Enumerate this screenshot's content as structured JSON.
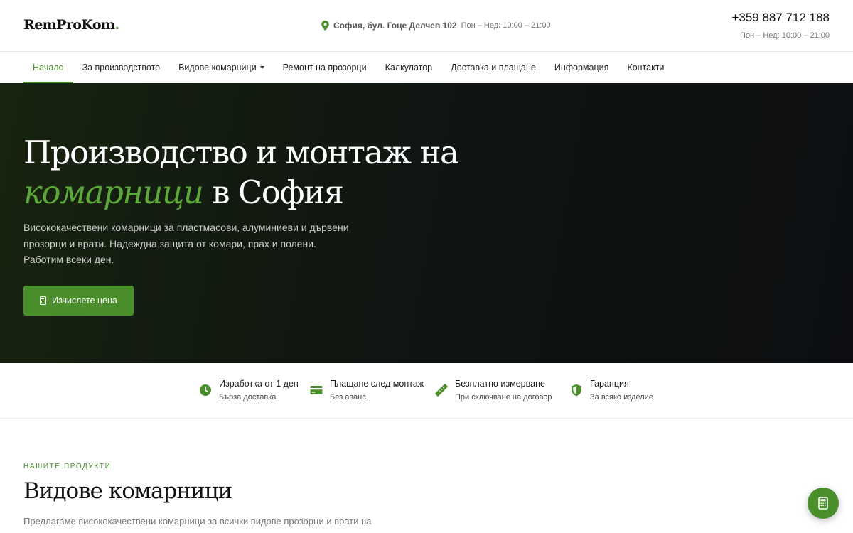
{
  "header": {
    "logo_main": "RemProKom",
    "logo_dot": ".",
    "address": "София, бул. Гоце Делчев 102",
    "address_hours": "Пон – Нед: 10:00 – 21:00",
    "phone": "+359 887 712 188",
    "phone_hours": "Пон – Нед: 10:00 – 21:00"
  },
  "nav": {
    "items": [
      {
        "label": "Начало"
      },
      {
        "label": "За производството"
      },
      {
        "label": "Видове комарници"
      },
      {
        "label": "Ремонт на прозорци"
      },
      {
        "label": "Калкулатор"
      },
      {
        "label": "Доставка и плащане"
      },
      {
        "label": "Информация"
      },
      {
        "label": "Контакти"
      }
    ],
    "active_index": 0
  },
  "hero": {
    "title_line1": "Производство и монтаж на",
    "title_accent": "комарници",
    "title_rest": " в София",
    "subtitle": "Висококачествени комарници за пластмасови, алуминиеви и дървени прозорци и врати. Надеждна защита от комари, прах и полени. Работим всеки ден.",
    "cta_label": "Изчислете цена"
  },
  "features": [
    {
      "title": "Изработка от 1 ден",
      "subtitle": "Бърза доставка",
      "icon": "clock-icon"
    },
    {
      "title": "Плащане след монтаж",
      "subtitle": "Без аванс",
      "icon": "credit-card-icon"
    },
    {
      "title": "Безплатно измерване",
      "subtitle": "При сключване на договор",
      "icon": "ruler-icon"
    },
    {
      "title": "Гаранция",
      "subtitle": "За всяко изделие",
      "icon": "shield-icon"
    }
  ],
  "products": {
    "eyebrow": "НАШИТЕ ПРОДУКТИ",
    "title": "Видове комарници",
    "description": "Предлагаме висококачествени комарници за всички видове прозорци и врати на"
  },
  "colors": {
    "accent": "#4a8f2c",
    "hero_bg": "#111611"
  }
}
